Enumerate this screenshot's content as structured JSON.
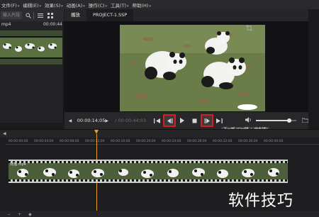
{
  "menubar": {
    "items": [
      {
        "label": "文件(F)"
      },
      {
        "label": "编辑(E)"
      },
      {
        "label": "效果(S)"
      },
      {
        "label": "动画(A)"
      },
      {
        "label": "操作(C)"
      },
      {
        "label": "工具(T)"
      },
      {
        "label": "帮助(H)"
      }
    ]
  },
  "left_panel": {
    "search_placeholder": "输入片段",
    "clip": {
      "name": "mp4",
      "duration": "00:00:44"
    }
  },
  "preview": {
    "tabs": [
      {
        "label": "播放"
      },
      {
        "label": "PROJECT-1.SSP"
      }
    ],
    "current_time": "00:00:14;05",
    "total_time": "/ 00:00:44;03",
    "volume_percent": 82,
    "tooltip": "下一帧 (Ctrl键 + 向右键)"
  },
  "timeline": {
    "ruler_ticks": [
      "00:00:00;00",
      "00:00:04;00",
      "00:00:08;00",
      "00:00:12;00",
      "00:00:16;00",
      "00:00:20;00",
      "00:00:24;00",
      "00:00:28;00",
      "00:00:32;00",
      "00:00:36;00",
      "00:00:40;00"
    ],
    "track_clip_label": "熊猫.mp4",
    "playhead_time_fraction": 0.3
  },
  "watermark": "软件技巧",
  "colors": {
    "highlight_border": "#d62020",
    "playhead": "#e8a024"
  }
}
